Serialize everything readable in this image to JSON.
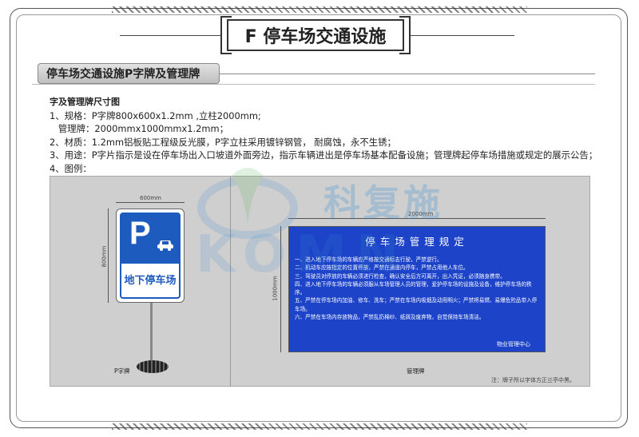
{
  "title": "F 停车场交通设施",
  "section_title": "停车场交通设施P字牌及管理牌",
  "spec": {
    "heading": "字及管理牌尺寸图",
    "lines": [
      "1、规格：P字牌800x600x1.2mm ,立柱2000mm;",
      "   管理牌：2000mmx1000mmx1.2mm；",
      "2、材质：1.2mm铝板贴工程级反光膜，P字立柱采用镀锌钢管， 耐腐蚀，永不生锈；",
      "3、用途：P字片指示是设在停车场出入口坡道外面旁边，指示车辆进出是停车场基本配备设施；管理牌起停车场措施或规定的展示公告；",
      "4、图例："
    ]
  },
  "watermark": {
    "cn": "科复施",
    "en": "KOMN"
  },
  "figure": {
    "p_sign": {
      "width_label": "600mm",
      "height_label": "800mm",
      "letter": "P",
      "label": "地下停车场",
      "caption": "P字牌"
    },
    "mgmt_sign": {
      "width_label": "2000mm",
      "height_label": "1000mm",
      "title": "停车场管理规定",
      "rules": [
        "一、进入地下停车场的车辆应严格按交通标志行驶，严禁逆行。",
        "二、机动车应按指定的位置停放，严禁在通道内停车，严禁占用他人车位。",
        "三、驾驶员对停放的车辆必须进行检查，确认安全后方可离开，出入凭证，必须随身携带。",
        "四、进入地下停车场的车辆必须服从车场管理人员的管理，爱护停车场的设施及设备，维护停车场的秩序。",
        "五、严禁在停车场内加油、修车、洗车；严禁在车场内吸烟及动用明火；严禁将易燃、易爆危险品带入停车场。",
        "六、严禁在车场内存放物品，严禁乱扔棉纱、纸屑及废弃物，自觉保持车场清洁。"
      ],
      "signature": "物业管理中心",
      "caption": "管理牌"
    },
    "note": "注：牌子所以字体方正兰亭中黑。"
  },
  "colors": {
    "sign_blue": "#1e5bbf",
    "board_blue": "#1c43c8",
    "figure_bg": "#cfcfcf"
  }
}
